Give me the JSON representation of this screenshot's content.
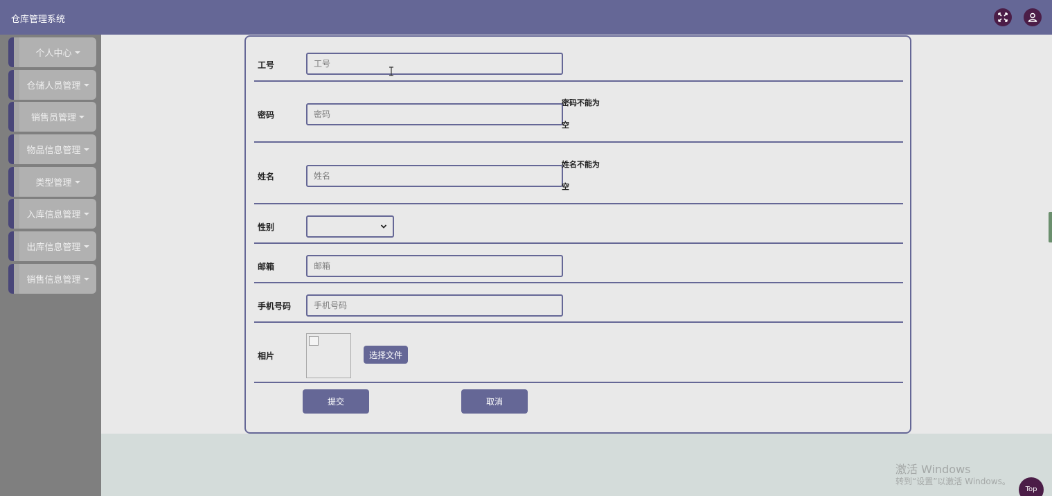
{
  "header": {
    "title": "仓库管理系统",
    "fullscreen_icon": "fullscreen-icon",
    "user_icon": "user-icon"
  },
  "sidebar": {
    "items": [
      {
        "label": "个人中心"
      },
      {
        "label": "仓储人员管理"
      },
      {
        "label": "销售员管理"
      },
      {
        "label": "物品信息管理"
      },
      {
        "label": "类型管理"
      },
      {
        "label": "入库信息管理"
      },
      {
        "label": "出库信息管理"
      },
      {
        "label": "销售信息管理"
      }
    ]
  },
  "form": {
    "employee_id": {
      "label": "工号",
      "placeholder": "工号",
      "value": ""
    },
    "password": {
      "label": "密码",
      "placeholder": "密码",
      "value": "",
      "error": "密码不能为空"
    },
    "name": {
      "label": "姓名",
      "placeholder": "姓名",
      "value": "",
      "error": "姓名不能为空"
    },
    "gender": {
      "label": "性别",
      "value": ""
    },
    "email": {
      "label": "邮箱",
      "placeholder": "邮箱",
      "value": ""
    },
    "phone": {
      "label": "手机号码",
      "placeholder": "手机号码",
      "value": ""
    },
    "photo": {
      "label": "相片",
      "choose_file_label": "选择文件"
    },
    "submit_label": "提交",
    "cancel_label": "取消"
  },
  "watermark": {
    "line1": "激活 Windows",
    "line2": "转到“设置”以激活 Windows。"
  },
  "back_to_top_label": "Top",
  "colors": {
    "header": "#656796",
    "sidebar": "#7f7f7f",
    "accent": "#656796",
    "icon_bg": "#4b1d47"
  }
}
